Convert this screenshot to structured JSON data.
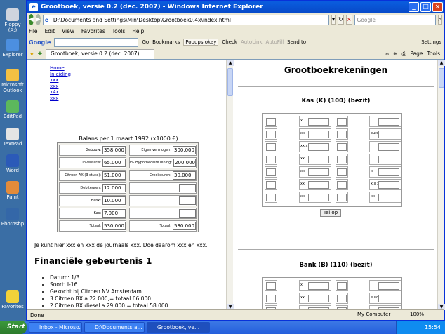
{
  "desktop": {
    "icons": [
      "Floppy (A:)",
      "Explorer",
      "Microsoft Outlook",
      "EditPad",
      "TextPad",
      "Word",
      "Paint",
      "Photoshp",
      "Favorites"
    ]
  },
  "window": {
    "title": "Grootboek, versie 0.2 (dec. 2007) - Windows Internet Explorer",
    "address": "D:\\Documents and Settings\\Min\\Desktop\\Grootboek0.4x\\index.html",
    "search_placeholder": "Google",
    "menu": [
      "File",
      "Edit",
      "View",
      "Favorites",
      "Tools",
      "Help"
    ],
    "google_bar": {
      "logo": "Google",
      "go": "Go",
      "bookmarks": "Bookmarks",
      "popups": "Popups okay",
      "check": "Check",
      "autolink": "AutoLink",
      "autofill": "AutoFill",
      "sendto": "Send to",
      "settings": "Settings"
    },
    "tab_title": "Grootboek, versie 0.2 (dec. 2007)",
    "tab_tools": [
      "Page",
      "Tools"
    ],
    "status": "Done",
    "zone": "My Computer",
    "zoom": "100%"
  },
  "left_frame": {
    "links": [
      "Home",
      "Inleiding",
      "xxx",
      "xxx",
      "x4x",
      "xxx"
    ],
    "balans_title": "Balans per 1 maart 1992 (x1000 €)",
    "debet": [
      {
        "label": "Gebouw:",
        "value": "358.000"
      },
      {
        "label": "Inventaris:",
        "value": "65.000"
      },
      {
        "label": "Citroen AX (3 stuks):",
        "value": "51.000"
      },
      {
        "label": "Debiteuren:",
        "value": "12.000"
      },
      {
        "label": "Bank:",
        "value": "10.000"
      },
      {
        "label": "Kas:",
        "value": "7.000"
      },
      {
        "label": "Totaal:",
        "value": "530.000"
      }
    ],
    "credit": [
      {
        "label": "Eigen vermogen:",
        "value": "300.000"
      },
      {
        "label": "7% Hypothecaire lening:",
        "value": "200.000"
      },
      {
        "label": "Crediteuren:",
        "value": "30.000"
      },
      {
        "label": "",
        "value": ""
      },
      {
        "label": "",
        "value": ""
      },
      {
        "label": "",
        "value": ""
      },
      {
        "label": "Totaal:",
        "value": "530.000"
      }
    ],
    "paragraph": "Je kunt hier xxx en xxx de journaals xxx. Doe daarom xxx en xxx.",
    "heading": "Financiële gebeurtenis 1",
    "events": [
      "Datum: 1/3",
      "Soort: I-16",
      "Gekocht bij Citroen NV Amsterdam",
      "3 Citroen BX a 22.000,= totaal 66.000",
      "2 Citroen BX diesel a 29.000 = totaal 58.000"
    ]
  },
  "right_frame": {
    "title": "Grootboekrekeningen",
    "kas_title": "Kas (K) (100) (bezit)",
    "kas_prefixes": [
      "x",
      "xx",
      "xx x",
      "xx",
      "xx",
      "xx",
      "xx"
    ],
    "kas_right_prefixes": [
      "",
      "euro",
      "",
      "",
      "x",
      "x x xx",
      "xx"
    ],
    "telop": "Tel op",
    "bank_title": "Bank (B) (110) (bezit)",
    "bank_prefixes": [
      "x",
      "xx",
      "xx"
    ],
    "bank_right_prefixes": [
      "",
      "euro",
      ""
    ]
  },
  "taskbar": {
    "start": "Start",
    "items": [
      "Inbox - Microso...",
      "D:\\Documents a...",
      "Grootboek, ve..."
    ],
    "time": "15:54"
  }
}
